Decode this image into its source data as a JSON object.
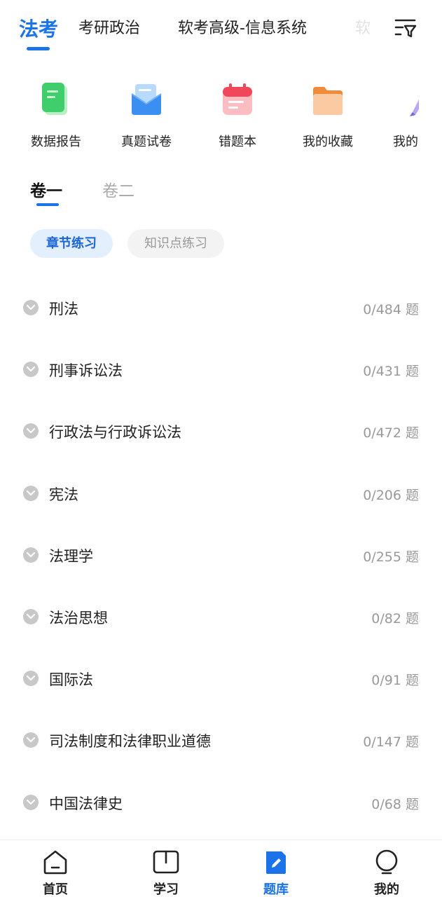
{
  "subject_tabs": [
    {
      "label": "法考",
      "active": true
    },
    {
      "label": "考研政治",
      "active": false
    },
    {
      "label": "软考高级-信息系统",
      "active": false
    },
    {
      "label": "软",
      "active": false
    }
  ],
  "quick_entries": [
    {
      "label": "数据报告",
      "icon": "data-report-icon"
    },
    {
      "label": "真题试卷",
      "icon": "exam-paper-icon"
    },
    {
      "label": "错题本",
      "icon": "wrong-book-icon"
    },
    {
      "label": "我的收藏",
      "icon": "favorites-folder-icon"
    },
    {
      "label": "我的",
      "icon": "pen-icon"
    }
  ],
  "volume_tabs": [
    {
      "label": "卷一",
      "active": true
    },
    {
      "label": "卷二",
      "active": false
    }
  ],
  "practice_modes": [
    {
      "label": "章节练习",
      "active": true
    },
    {
      "label": "知识点练习",
      "active": false
    }
  ],
  "chapters": [
    {
      "name": "刑法",
      "progress": "0/484 题"
    },
    {
      "name": "刑事诉讼法",
      "progress": "0/431 题"
    },
    {
      "name": "行政法与行政诉讼法",
      "progress": "0/472 题"
    },
    {
      "name": "宪法",
      "progress": "0/206 题"
    },
    {
      "name": "法理学",
      "progress": "0/255 题"
    },
    {
      "name": "法治思想",
      "progress": "0/82 题"
    },
    {
      "name": "国际法",
      "progress": "0/91 题"
    },
    {
      "name": "司法制度和法律职业道德",
      "progress": "0/147 题"
    },
    {
      "name": "中国法律史",
      "progress": "0/68 题"
    }
  ],
  "bottom_nav": [
    {
      "label": "首页",
      "icon": "home-icon",
      "active": false
    },
    {
      "label": "学习",
      "icon": "book-icon",
      "active": false
    },
    {
      "label": "题库",
      "icon": "question-bank-icon",
      "active": true
    },
    {
      "label": "我的",
      "icon": "profile-icon",
      "active": false
    }
  ],
  "colors": {
    "accent": "#1a73e8",
    "chip_active_bg": "#e4effd",
    "muted_text": "#999999"
  }
}
